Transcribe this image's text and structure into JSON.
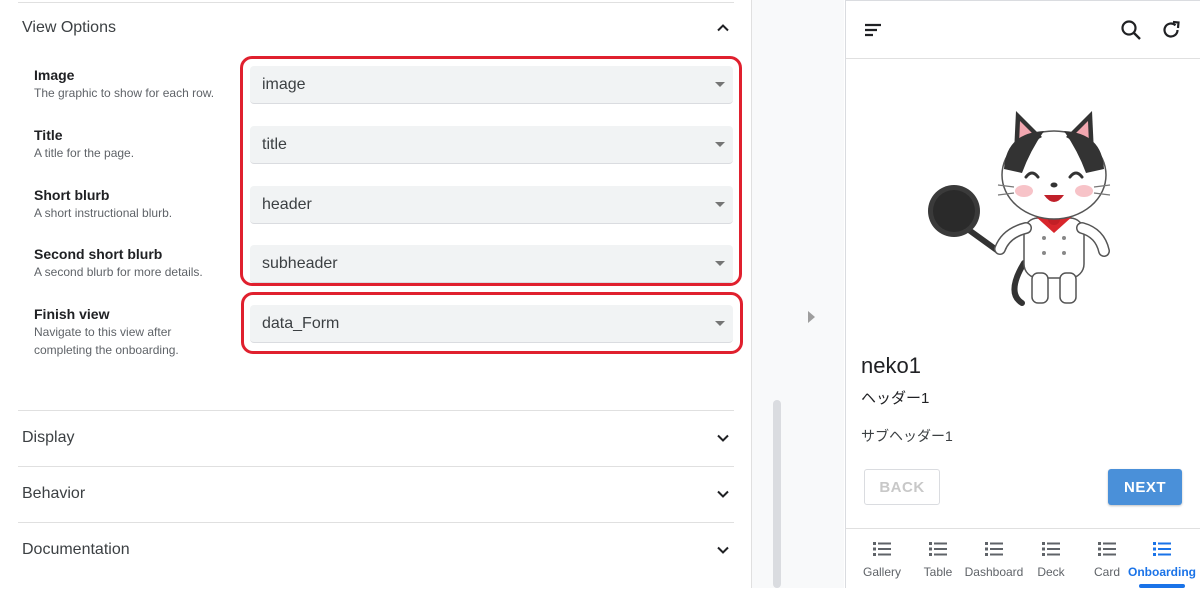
{
  "editor": {
    "sections": {
      "view_options": "View Options",
      "display": "Display",
      "behavior": "Behavior",
      "documentation": "Documentation"
    },
    "options": [
      {
        "title": "Image",
        "desc": "The graphic to show for each row.",
        "value": "image"
      },
      {
        "title": "Title",
        "desc": "A title for the page.",
        "value": "title"
      },
      {
        "title": "Short blurb",
        "desc": "A short instructional blurb.",
        "value": "header"
      },
      {
        "title": "Second short blurb",
        "desc": "A second blurb for more details.",
        "value": "subheader"
      }
    ],
    "finish_view": {
      "title": "Finish view",
      "desc_line1": "Navigate to this view after",
      "desc_line2": "completing the onboarding.",
      "value": "data_Form"
    },
    "highlight_color": "#e0202e"
  },
  "preview": {
    "title": "neko1",
    "header": "ヘッダー1",
    "subheader": "サブヘッダー1",
    "back_label": "BACK",
    "next_label": "NEXT",
    "accent_color": "#4a90d9",
    "nav": [
      {
        "label": "Gallery",
        "icon": "list-icon"
      },
      {
        "label": "Table",
        "icon": "list-icon"
      },
      {
        "label": "Dashboard",
        "icon": "list-icon"
      },
      {
        "label": "Deck",
        "icon": "list-icon"
      },
      {
        "label": "Card",
        "icon": "list-icon"
      },
      {
        "label": "Onboarding",
        "icon": "list-icon",
        "active": true
      }
    ]
  }
}
